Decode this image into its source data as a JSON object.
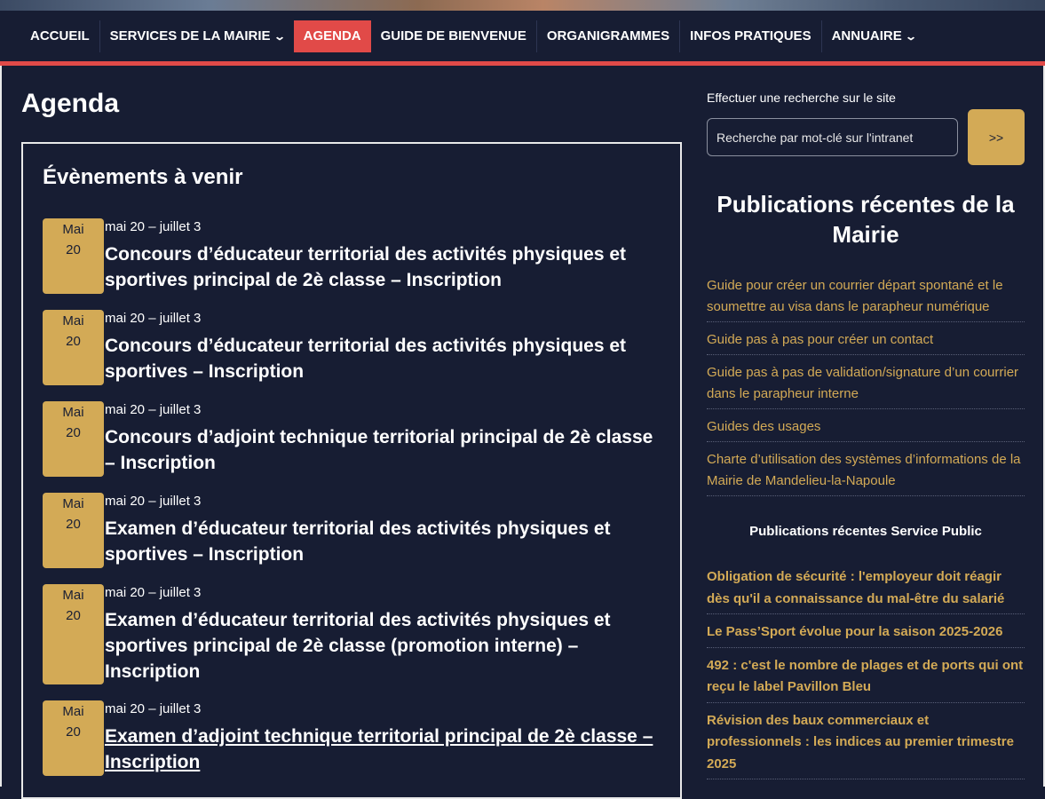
{
  "nav": {
    "items": [
      {
        "label": "ACCUEIL",
        "dropdown": false
      },
      {
        "label": "SERVICES DE LA MAIRIE",
        "dropdown": true
      },
      {
        "label": "AGENDA",
        "dropdown": false,
        "active": true
      },
      {
        "label": "GUIDE DE BIENVENUE",
        "dropdown": false
      },
      {
        "label": "ORGANIGRAMMES",
        "dropdown": false
      },
      {
        "label": "INFOS PRATIQUES",
        "dropdown": false
      },
      {
        "label": "ANNUAIRE",
        "dropdown": true
      }
    ]
  },
  "main": {
    "page_title": "Agenda",
    "events_title": "Évènements à venir",
    "events": [
      {
        "month": "Mai",
        "day": "20",
        "range": "mai 20 – juillet 3",
        "title": "Concours d’éducateur territorial des activités physiques et sportives principal de 2è classe – Inscription"
      },
      {
        "month": "Mai",
        "day": "20",
        "range": "mai 20 – juillet 3",
        "title": "Concours d’éducateur territorial des activités physiques et sportives – Inscription"
      },
      {
        "month": "Mai",
        "day": "20",
        "range": "mai 20 – juillet 3",
        "title": "Concours d’adjoint technique territorial principal de 2è classe – Inscription"
      },
      {
        "month": "Mai",
        "day": "20",
        "range": "mai 20 – juillet 3",
        "title": "Examen d’éducateur territorial des activités physiques et sportives – Inscription"
      },
      {
        "month": "Mai",
        "day": "20",
        "range": "mai 20 – juillet 3",
        "title": "Examen d’éducateur territorial des activités physiques et sportives principal de 2è classe (promotion interne) – Inscription"
      },
      {
        "month": "Mai",
        "day": "20",
        "range": "mai 20 – juillet 3",
        "title": "Examen d’adjoint technique territorial principal de 2è classe – Inscription"
      }
    ]
  },
  "sidebar": {
    "search_label": "Effectuer une recherche sur le site",
    "search_placeholder": "Recherche par mot-clé sur l'intranet",
    "search_button": ">>",
    "publications_title": "Publications récentes de la Mairie",
    "publications": [
      "Guide pour créer un courrier départ spontané et le soumettre au visa dans le parapheur numérique",
      "Guide pas à pas pour créer un contact",
      "Guide pas à pas de validation/signature d’un courrier dans le parapheur interne",
      "Guides des usages",
      "Charte d’utilisation des systèmes d’informations de la Mairie de Mandelieu-la-Napoule"
    ],
    "service_public_title": "Publications récentes Service Public",
    "service_public": [
      "Obligation de sécurité : l'employeur doit réagir dès qu'il a connaissance du mal-être du salarié",
      "Le Pass’Sport évolue pour la saison 2025-2026",
      "492 : c'est le nombre de plages et de ports qui ont reçu le label Pavillon Bleu",
      "Révision des baux commerciaux et professionnels : les indices au premier trimestre 2025"
    ]
  },
  "colors": {
    "accent_red": "#e14a48",
    "gold": "#d3aa56",
    "background": "#171d33"
  }
}
